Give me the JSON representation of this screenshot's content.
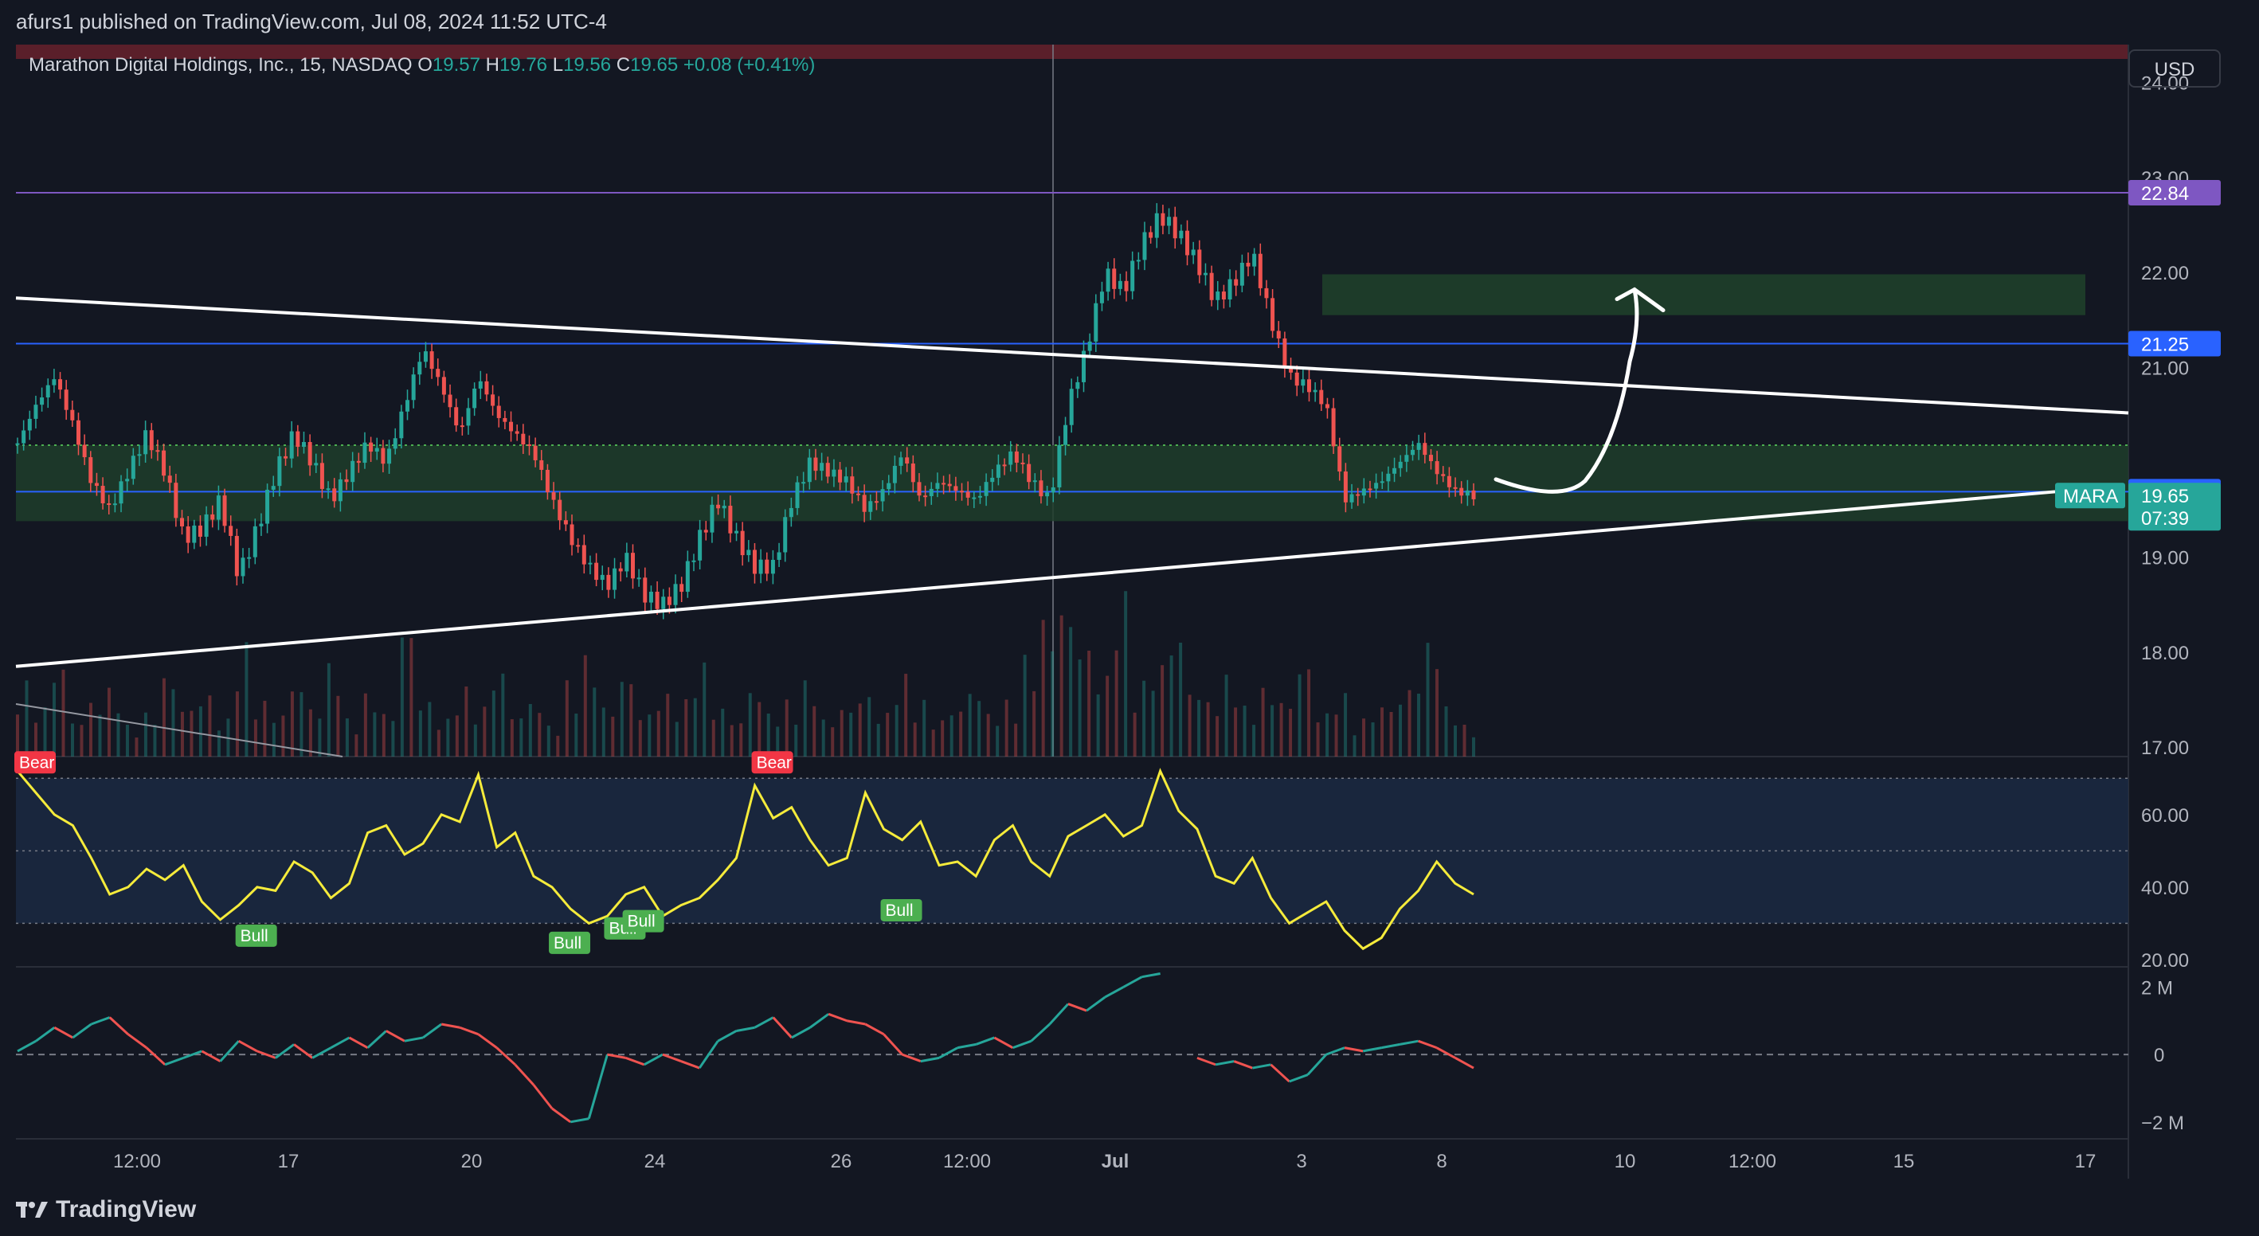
{
  "header": {
    "published": "afurs1 published on TradingView.com, Jul 08, 2024 11:52 UTC-4"
  },
  "legend": {
    "symbol": "Marathon Digital Holdings, Inc., 15, NASDAQ",
    "o_label": "O",
    "o_value": "19.57",
    "h_label": "H",
    "h_value": "19.76",
    "l_label": "L",
    "l_value": "19.56",
    "c_label": "C",
    "c_value": "19.65",
    "change": "+0.08 (+0.41%)"
  },
  "currency": "USD",
  "footer": {
    "brand": "TradingView"
  },
  "colors": {
    "background": "#131722",
    "up": "#26a69a",
    "down": "#ef5350",
    "rsi_line": "#f5eb3b",
    "resistance_purple": "#7e57c2",
    "level_blue": "#2962ff",
    "zone_green": "#1e3d2a",
    "bull_badge": "#4caf50",
    "bear_badge": "#f23645"
  },
  "chart_data": [
    {
      "type": "candlestick",
      "title": "",
      "ylim": [
        16.9,
        24.4
      ],
      "y_ticks": [
        "24.00",
        "23.00",
        "22.00",
        "21.00",
        "19.00",
        "18.00",
        "17.00"
      ],
      "x_ticks": [
        "12:00",
        "17",
        "20",
        "24",
        "26",
        "12:00",
        "Jul",
        "3",
        "8",
        "10",
        "12:00",
        "15",
        "17"
      ],
      "price_labels": [
        {
          "value": 22.84,
          "label": "22.84",
          "color": "#7e57c2"
        },
        {
          "value": 21.25,
          "label": "21.25",
          "color": "#2962ff"
        },
        {
          "value": 19.69,
          "label": "19.69",
          "color": "#2962ff"
        },
        {
          "value": 19.65,
          "label": "19.65",
          "sub": "07:39",
          "ticker": "MARA",
          "color": "#26a69a"
        }
      ],
      "zones": [
        {
          "from": 19.38,
          "to": 20.18,
          "color": "#1e3d2a"
        },
        {
          "from": 21.55,
          "to": 21.98,
          "color": "#1e3d2a"
        }
      ],
      "horizontal_lines": [
        22.84,
        21.25,
        19.69
      ],
      "close_path": [
        20.2,
        20.6,
        20.9,
        20.4,
        19.8,
        19.5,
        19.9,
        20.3,
        19.9,
        19.2,
        19.3,
        19.6,
        18.8,
        19.3,
        19.9,
        20.3,
        20.0,
        19.6,
        19.9,
        20.2,
        20.0,
        20.6,
        21.2,
        20.8,
        20.3,
        20.9,
        20.5,
        20.3,
        20.1,
        19.6,
        19.2,
        18.9,
        18.7,
        19.0,
        18.6,
        18.5,
        18.7,
        19.2,
        19.6,
        19.2,
        18.9,
        18.9,
        19.6,
        20.0,
        19.9,
        19.8,
        19.5,
        19.7,
        20.1,
        19.6,
        19.8,
        19.7,
        19.6,
        19.9,
        20.1,
        19.8,
        19.6,
        20.6,
        21.2,
        22.0,
        21.8,
        22.3,
        22.6,
        22.4,
        22.1,
        21.7,
        21.9,
        22.2,
        21.5,
        20.9,
        20.8,
        20.6,
        19.6,
        19.7,
        19.8,
        20.0,
        20.2,
        19.9,
        19.7,
        19.65
      ],
      "volume_path": [
        1.2,
        0.8,
        1.5,
        0.6,
        0.9,
        1.1,
        0.5,
        0.7,
        1.3,
        0.8,
        1.0,
        0.6,
        1.8,
        0.9,
        0.7,
        1.2,
        0.8,
        1.5,
        0.6,
        1.0,
        0.7,
        2.1,
        0.9,
        0.6,
        1.1,
        0.8,
        1.4,
        0.7,
        0.9,
        0.5,
        1.2,
        1.6,
        0.8,
        1.3,
        0.7,
        1.0,
        0.9,
        1.5,
        0.8,
        0.6,
        1.1,
        0.7,
        0.9,
        1.2,
        0.6,
        0.8,
        1.0,
        0.7,
        1.3,
        0.9,
        0.6,
        0.8,
        1.1,
        0.7,
        0.9,
        1.6,
        2.2,
        2.4,
        1.8,
        1.3,
        2.6,
        1.2,
        1.5,
        2.0,
        1.1,
        0.9,
        1.3,
        0.8,
        1.1,
        0.9,
        1.5,
        0.7,
        1.0,
        0.6,
        0.8,
        0.9,
        1.2,
        1.9,
        0.8,
        0.5
      ],
      "trendlines": [
        {
          "from": [
            0,
            21.73
          ],
          "to": [
            1.0,
            20.52
          ]
        },
        {
          "from": [
            0,
            17.85
          ],
          "to": [
            1.0,
            19.69
          ]
        }
      ],
      "projection_arrow": {
        "start": 19.72,
        "peak": 21.82
      },
      "annotations": [
        "MARA"
      ]
    },
    {
      "type": "line",
      "title": "",
      "ylim": [
        18,
        76
      ],
      "y_ticks": [
        "60.00",
        "40.00",
        "20.00"
      ],
      "band": [
        30,
        70
      ],
      "mid": 50,
      "values": [
        72,
        66,
        60,
        57,
        48,
        38,
        40,
        45,
        42,
        46,
        36,
        31,
        35,
        40,
        39,
        47,
        44,
        37,
        41,
        55,
        57,
        49,
        52,
        60,
        58,
        71,
        51,
        55,
        43,
        40,
        34,
        30,
        32,
        38,
        40,
        32,
        35,
        37,
        42,
        48,
        68,
        59,
        62,
        53,
        46,
        48,
        66,
        56,
        53,
        58,
        46,
        47,
        43,
        53,
        57,
        47,
        43,
        54,
        57,
        60,
        54,
        57,
        72,
        61,
        56,
        43,
        41,
        48,
        37,
        30,
        33,
        36,
        28,
        23,
        26,
        34,
        39,
        47,
        41,
        38
      ],
      "badges": [
        {
          "text": "Bear",
          "index": 0,
          "value": 70
        },
        {
          "text": "Bull",
          "index": 12,
          "value": 31
        },
        {
          "text": "Bull",
          "index": 29,
          "value": 29
        },
        {
          "text": "Bull",
          "index": 32,
          "value": 33
        },
        {
          "text": "Bull",
          "index": 33,
          "value": 35
        },
        {
          "text": "Bear",
          "index": 40,
          "value": 70
        },
        {
          "text": "Bull",
          "index": 47,
          "value": 38
        }
      ]
    },
    {
      "type": "line",
      "title": "",
      "ylim": [
        -2.5,
        2.6
      ],
      "y_ticks": [
        "2 M",
        "0",
        "−2 M"
      ],
      "zero_line": 0,
      "values": [
        0.1,
        0.4,
        0.8,
        0.5,
        0.9,
        1.1,
        0.6,
        0.2,
        -0.3,
        -0.1,
        0.1,
        -0.2,
        0.4,
        0.1,
        -0.1,
        0.3,
        -0.1,
        0.2,
        0.5,
        0.2,
        0.7,
        0.4,
        0.5,
        0.9,
        0.8,
        0.6,
        0.2,
        -0.3,
        -0.9,
        -1.6,
        -2.0,
        -1.9,
        0.0,
        -0.1,
        -0.3,
        0.0,
        -0.2,
        -0.4,
        0.4,
        0.7,
        0.8,
        1.1,
        0.5,
        0.8,
        1.2,
        1.0,
        0.9,
        0.6,
        0.0,
        -0.2,
        -0.1,
        0.2,
        0.3,
        0.5,
        0.2,
        0.4,
        0.9,
        1.5,
        1.3,
        1.7,
        2.0,
        2.3,
        2.4,
        null,
        -0.1,
        -0.3,
        -0.2,
        -0.4,
        -0.3,
        -0.8,
        -0.6,
        0.0,
        0.2,
        0.1,
        0.2,
        0.3,
        0.4,
        0.2,
        -0.1,
        -0.4
      ]
    }
  ]
}
